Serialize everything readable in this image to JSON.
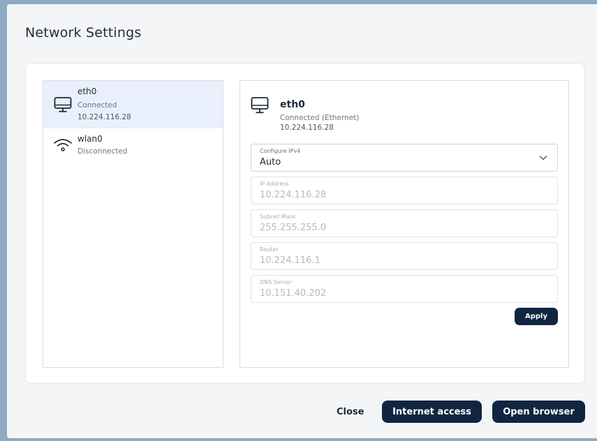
{
  "window": {
    "title": "Network Settings"
  },
  "interfaces": [
    {
      "name": "eth0",
      "status": "Connected",
      "ip": "10.224.116.28",
      "icon": "monitor-icon",
      "selected": true
    },
    {
      "name": "wlan0",
      "status": "Disconnected",
      "ip": "",
      "icon": "wifi-icon",
      "selected": false
    }
  ],
  "detail": {
    "name": "eth0",
    "status": "Connected (Ethernet)",
    "ip": "10.224.116.28",
    "icon": "monitor-icon",
    "configure": {
      "label": "Configure IPv4",
      "value": "Auto"
    },
    "fields": {
      "ip_address": {
        "label": "IP Address",
        "value": "10.224.116.28"
      },
      "subnet_mask": {
        "label": "Subnet Mask",
        "value": "255.255.255.0"
      },
      "router": {
        "label": "Router",
        "value": "10.224.116.1"
      },
      "dns_server": {
        "label": "DNS Server",
        "value": "10.151.40.202"
      }
    },
    "apply_label": "Apply"
  },
  "footer": {
    "close_label": "Close",
    "internet_label": "Internet access",
    "browser_label": "Open browser"
  },
  "colors": {
    "accent": "#0f2540",
    "selected_bg": "#e9f0fb",
    "outer_bg": "#8ea9c1"
  }
}
